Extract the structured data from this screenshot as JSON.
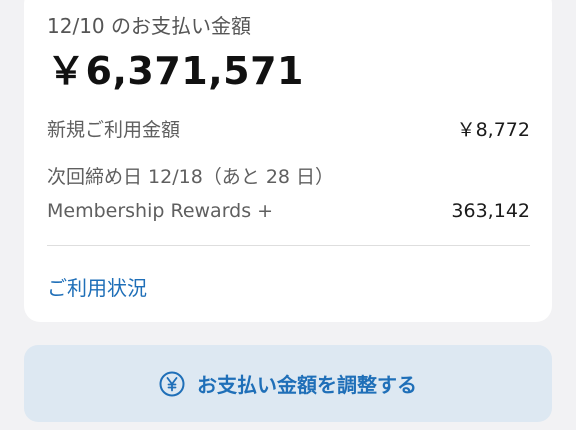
{
  "payment": {
    "due_label": "12/10 のお支払い金額",
    "due_amount": "￥6,371,571"
  },
  "details": {
    "new_usage_label": "新規ご利用金額",
    "new_usage_value": "￥8,772",
    "closing_info": "次回締め日 12/18（あと 28 日）",
    "rewards_label": "Membership Rewards +",
    "rewards_value": "363,142"
  },
  "links": {
    "usage_status": "ご利用状況"
  },
  "actions": {
    "adjust_payment_label": "お支払い金額を調整する",
    "adjust_icon": "yen-circle-icon"
  },
  "colors": {
    "accent": "#1f6fb8",
    "button_bg": "#dde8f2",
    "page_bg": "#f2f2f4"
  }
}
